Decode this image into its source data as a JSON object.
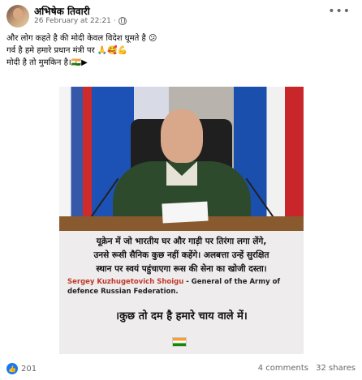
{
  "post": {
    "author": "अभिषेक तिवारी",
    "timestamp": "26 February at 22:21",
    "text_lines": [
      "और लोग कहते है की मोदी केवल विदेश घूमते है 😕",
      "गर्व है हमे हमारे प्रधान मंत्री पर 🙏🥰💪",
      "मोदी है तो मुमकिन है।🇮🇳▶"
    ]
  },
  "image": {
    "quote_lines": [
      "यूक्रेन में जो भारतीय घर और गाड़ी पर तिरंगा लगा लेंगे,",
      "उनसे रूसी सैनिक कुछ नहीं कहेंगे। अलबत्ता उन्हें सुरक्षित",
      "स्थान पर स्वयं पहुंचाएगा रूस की सेना का खोजी दस्ता।"
    ],
    "person_name": "Sergey Kuzhugetovich Shoigu",
    "person_title": "- General of the Army of defence Russian Federation.",
    "tagline": "।कुछ तो दम है हमारे चाय वाले में।"
  },
  "footer": {
    "reaction_count": "201",
    "comments": "4 comments",
    "shares": "32 shares"
  },
  "colors": {
    "like_blue": "#1877f2",
    "name_red": "#c0392b"
  },
  "icons": [
    "globe-icon",
    "more-options-icon",
    "like-reaction-icon",
    "indian-flag-icon"
  ]
}
